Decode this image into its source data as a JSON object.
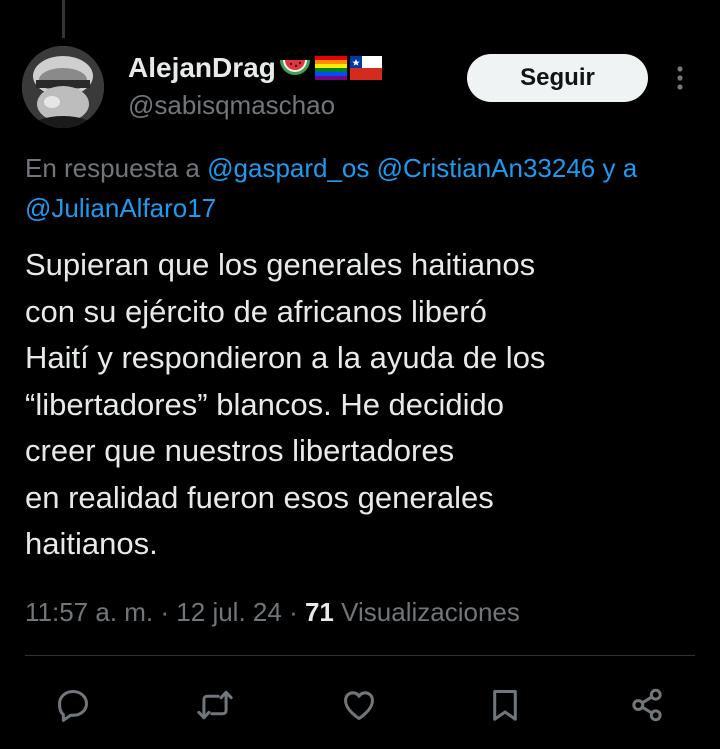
{
  "author": {
    "display_name": "AlejanDrag",
    "handle": "@sabisqmaschao",
    "name_emojis": [
      "watermelon-emoji",
      "rainbow-flag-emoji",
      "chile-flag-emoji"
    ]
  },
  "follow_button": {
    "label": "Seguir"
  },
  "reply_context": {
    "prefix": "En respuesta a",
    "mention_1": "@gaspard_os",
    "mention_2": "@CristianAn33246",
    "trailing": "y a",
    "mention_3": "@JulianAlfaro17"
  },
  "tweet": {
    "lines": [
      "Supieran que los generales haitianos",
      "con su ejército de africanos liberó",
      "Haití y respondieron a la ayuda de los",
      "“libertadores” blancos. He decidido",
      "creer que nuestros libertadores",
      "en realidad fueron esos generales",
      "haitianos."
    ]
  },
  "meta": {
    "time": "11:57 a. m.",
    "sep": "·",
    "date": "12 jul. 24",
    "views_count": "71",
    "views_label": "Visualizaciones"
  },
  "actions": {
    "icons": [
      "reply-icon",
      "retweet-icon",
      "like-icon",
      "bookmark-icon",
      "share-icon"
    ]
  },
  "colors": {
    "background": "#000000",
    "text": "#e7e9ea",
    "secondary": "#71767b",
    "link": "#1d9bf0",
    "button_bg": "#eff3f4"
  }
}
